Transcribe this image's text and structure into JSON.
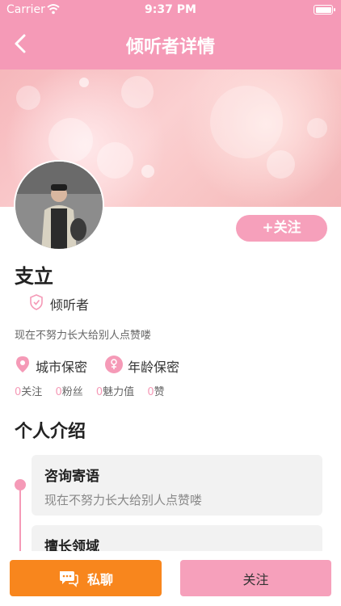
{
  "status_bar": {
    "carrier": "Carrier",
    "time": "9:37 PM"
  },
  "nav": {
    "title": "倾听者详情"
  },
  "profile": {
    "follow_pill": "+关注",
    "name": "支立",
    "role": "倾听者",
    "bio": "现在不努力长大给别人点赞喽",
    "city": "城市保密",
    "age": "年龄保密",
    "stats": [
      {
        "num": "0",
        "label": "关注"
      },
      {
        "num": "0",
        "label": "粉丝"
      },
      {
        "num": "0",
        "label": "魅力值"
      },
      {
        "num": "0",
        "label": "赞"
      }
    ]
  },
  "intro": {
    "section_title": "个人介绍",
    "cards": [
      {
        "title": "咨询寄语",
        "text": "现在不努力长大给别人点赞喽"
      },
      {
        "title": "擅长领域",
        "text": ""
      }
    ]
  },
  "bottom": {
    "chat_label": "私聊",
    "follow_label": "关注"
  },
  "colors": {
    "accent": "#f59ab7",
    "chat_button": "#f8861d"
  }
}
